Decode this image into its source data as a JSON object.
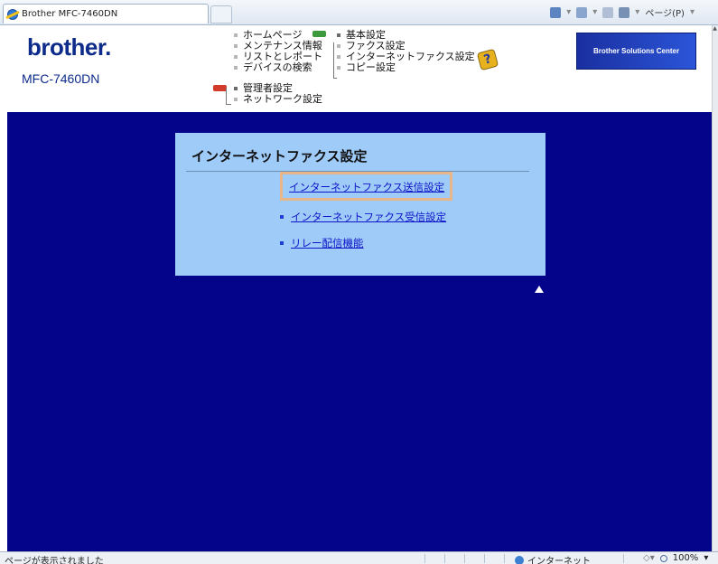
{
  "browser": {
    "tab_title": "Brother MFC-7460DN",
    "page_menu_label": "ページ(P)"
  },
  "header": {
    "brand": "brother.",
    "model": "MFC-7460DN",
    "solutions_label": "Brother Solutions Center",
    "nav_col1": [
      "ホームページ",
      "メンテナンス情報",
      "リストとレポート",
      "デバイスの検索"
    ],
    "nav_col2": [
      "基本設定",
      "ファクス設定",
      "インターネットファクス設定",
      "コピー設定"
    ],
    "admin_label": "管理者設定",
    "network_label": "ネットワーク設定"
  },
  "panel": {
    "title": "インターネットファクス設定",
    "links": [
      "インターネットファクス送信設定",
      "インターネットファクス受信設定",
      "リレー配信機能"
    ]
  },
  "status": {
    "message": "ページが表示されました",
    "zone": "インターネット",
    "zoom": "100%"
  }
}
